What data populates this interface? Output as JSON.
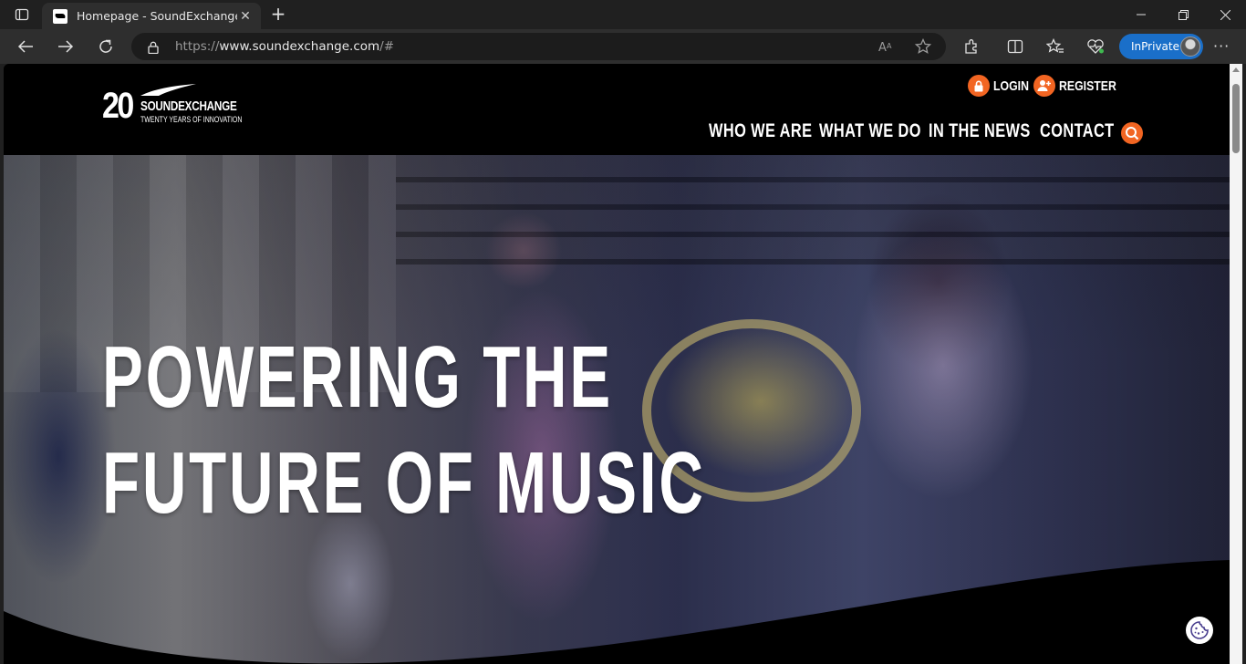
{
  "browser": {
    "tab": {
      "title": "Homepage - SoundExchangeSou"
    },
    "address": {
      "scheme": "https://",
      "host": "www.soundexchange.com",
      "path": "/#"
    },
    "inprivate_label": "InPrivate"
  },
  "site": {
    "logo": {
      "number": "20",
      "name": "SOUNDEXCHANGE",
      "tagline": "TWENTY YEARS OF INNOVATION"
    },
    "util": {
      "login": "LOGIN",
      "register": "REGISTER"
    },
    "nav": [
      {
        "label": "WHO WE ARE"
      },
      {
        "label": "WHAT WE DO"
      },
      {
        "label": "IN THE NEWS"
      },
      {
        "label": "CONTACT"
      }
    ],
    "hero": {
      "line1": "POWERING THE",
      "line2": "FUTURE OF MUSIC"
    }
  },
  "colors": {
    "accent": "#f26522",
    "inprivate": "#1a6fc9",
    "header_bg": "#000000"
  },
  "icons": [
    "tab-actions-icon",
    "back-icon",
    "forward-icon",
    "refresh-icon",
    "lock-icon",
    "read-aloud-icon",
    "favorite-star-icon",
    "extensions-icon",
    "split-screen-icon",
    "favorites-icon",
    "browser-essentials-icon",
    "more-icon",
    "search-icon",
    "cookie-icon"
  ]
}
